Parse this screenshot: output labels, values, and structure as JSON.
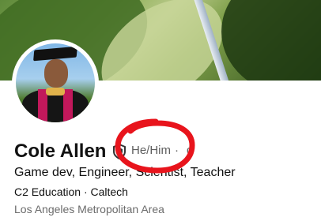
{
  "profile": {
    "name": "Cole Allen",
    "pronouns": "He/Him",
    "separator": "·",
    "tail_partial": "d",
    "headline": "Game dev, Engineer, Scientist,  Teacher",
    "education": "C2 Education · Caltech",
    "location": "Los Angeles Metropolitan Area"
  },
  "annotation": {
    "type": "hand-drawn circle",
    "color": "#e8141c"
  },
  "icons": {
    "verified": "shield-icon"
  }
}
